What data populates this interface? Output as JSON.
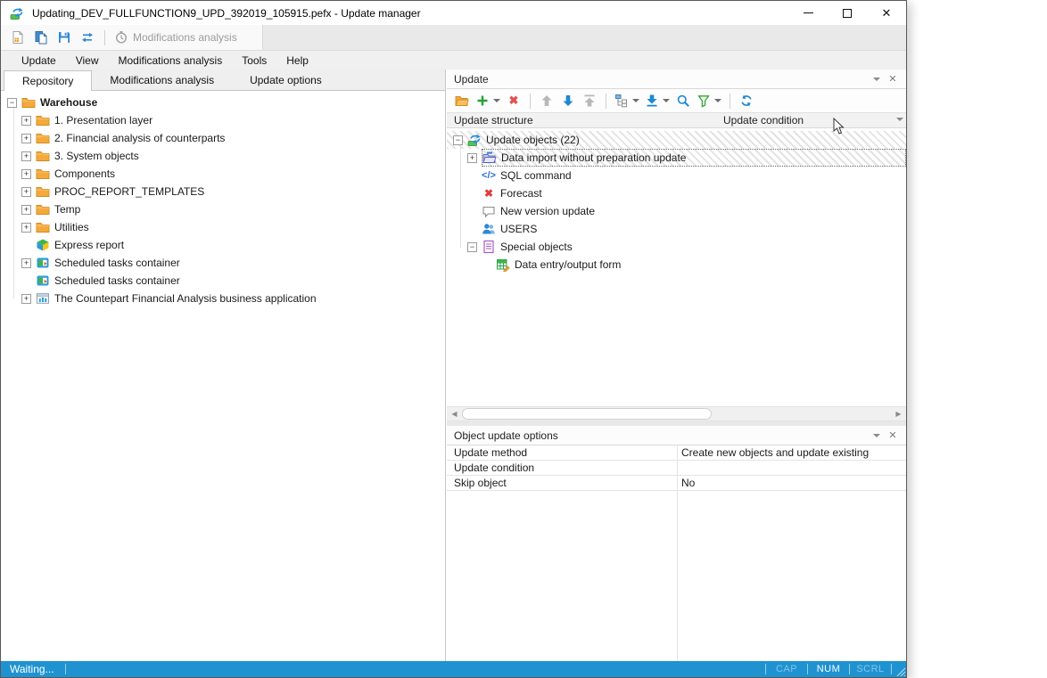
{
  "window": {
    "title": "Updating_DEV_FULLFUNCTION9_UPD_392019_105915.pefx - Update manager"
  },
  "colors": {
    "status_blue": "#1f93d1",
    "accent_blue": "#1e88d0",
    "folder_orange": "#f3a63a",
    "green": "#2ba23c",
    "red": "#e04040"
  },
  "main_toolbar": {
    "buttons": [
      {
        "name": "new-button",
        "icon": "new-doc-icon"
      },
      {
        "name": "copy-button",
        "icon": "copy-icon"
      },
      {
        "name": "save-button",
        "icon": "save-icon"
      },
      {
        "name": "sync-button",
        "icon": "sync-icon"
      },
      {
        "sep": true
      },
      {
        "name": "modifications-analysis-button",
        "icon": "clock-icon",
        "label": "Modifications analysis",
        "disabled": true
      }
    ]
  },
  "menu_bar": {
    "items": [
      {
        "label": "Update"
      },
      {
        "label": "View"
      },
      {
        "label": "Modifications analysis"
      },
      {
        "label": "Tools"
      },
      {
        "label": "Help"
      }
    ]
  },
  "tab_bar": {
    "tabs": [
      {
        "label": "Repository",
        "active": true
      },
      {
        "label": "Modifications analysis",
        "active": false
      },
      {
        "label": "Update options",
        "active": false
      }
    ]
  },
  "repository_tree": {
    "items": [
      {
        "level": 0,
        "expander": "minus",
        "icon": "folder-icon",
        "label": "Warehouse",
        "bold": true
      },
      {
        "level": 1,
        "expander": "plus",
        "icon": "folder-icon",
        "label": "1. Presentation layer"
      },
      {
        "level": 1,
        "expander": "plus",
        "icon": "folder-icon",
        "label": "2. Financial analysis of counterparts"
      },
      {
        "level": 1,
        "expander": "plus",
        "icon": "folder-icon",
        "label": "3. System objects"
      },
      {
        "level": 1,
        "expander": "plus",
        "icon": "folder-icon",
        "label": "Components"
      },
      {
        "level": 1,
        "expander": "plus",
        "icon": "folder-icon",
        "label": "PROC_REPORT_TEMPLATES"
      },
      {
        "level": 1,
        "expander": "plus",
        "icon": "folder-icon",
        "label": "Temp"
      },
      {
        "level": 1,
        "expander": "plus",
        "icon": "folder-icon",
        "label": "Utilities"
      },
      {
        "level": 1,
        "expander": "none",
        "icon": "cube-icon",
        "label": "Express report"
      },
      {
        "level": 1,
        "expander": "plus",
        "icon": "tasks-icon",
        "label": "Scheduled tasks container"
      },
      {
        "level": 1,
        "expander": "none",
        "icon": "tasks-icon",
        "label": "Scheduled tasks container"
      },
      {
        "level": 1,
        "expander": "plus",
        "icon": "app-chart-icon",
        "label": "The Countepart Financial Analysis business application"
      }
    ]
  },
  "update_panel": {
    "title": "Update",
    "columns": {
      "structure": "Update structure",
      "condition": "Update condition"
    },
    "toolbar": {
      "buttons": [
        {
          "name": "open-button",
          "icon": "folder-open-icon"
        },
        {
          "name": "add-button",
          "icon": "plus-icon",
          "caret": true
        },
        {
          "name": "delete-button",
          "icon": "delete-x-icon"
        },
        {
          "sep": true
        },
        {
          "name": "move-up-button",
          "icon": "arrow-up-icon",
          "disabled": true
        },
        {
          "name": "move-down-button",
          "icon": "arrow-down-icon"
        },
        {
          "name": "move-top-button",
          "icon": "arrow-top-icon",
          "disabled": true
        },
        {
          "sep": true
        },
        {
          "name": "structure-button",
          "icon": "tree-structure-icon",
          "caret": true
        },
        {
          "name": "move-bottom-button",
          "icon": "arrow-bottom-icon",
          "caret": true
        },
        {
          "name": "search-button",
          "icon": "search-icon"
        },
        {
          "name": "filter-button",
          "icon": "filter-icon",
          "caret": true
        },
        {
          "sep": true
        },
        {
          "name": "refresh-button",
          "icon": "refresh-icon"
        }
      ]
    },
    "tree": {
      "items": [
        {
          "level": 0,
          "expander": "minus",
          "icon": "update-icon",
          "label": "Update objects (22)",
          "hatched": true
        },
        {
          "level": 1,
          "expander": "plus",
          "icon": "import-folder-icon",
          "label": "Data import without preparation update",
          "hatched": true,
          "selected": true
        },
        {
          "level": 1,
          "expander": "none",
          "icon": "sql-icon",
          "label": "SQL command"
        },
        {
          "level": 1,
          "expander": "none",
          "icon": "red-x-icon",
          "label": "Forecast"
        },
        {
          "level": 1,
          "expander": "none",
          "icon": "comment-icon",
          "label": "New version update"
        },
        {
          "level": 1,
          "expander": "none",
          "icon": "users-icon",
          "label": "USERS"
        },
        {
          "level": 1,
          "expander": "minus",
          "icon": "special-doc-icon",
          "label": "Special objects"
        },
        {
          "level": 2,
          "expander": "none",
          "icon": "form-icon",
          "label": "Data entry/output form"
        }
      ]
    }
  },
  "options_panel": {
    "title": "Object update options",
    "rows": [
      {
        "label": "Update method",
        "value": "Create new objects and update existing"
      },
      {
        "label": "Update condition",
        "value": ""
      },
      {
        "label": "Skip object",
        "value": "No"
      }
    ]
  },
  "status_bar": {
    "message": "Waiting...",
    "indicators": [
      {
        "label": "CAP",
        "active": false
      },
      {
        "label": "NUM",
        "active": true
      },
      {
        "label": "SCRL",
        "active": false
      }
    ]
  }
}
